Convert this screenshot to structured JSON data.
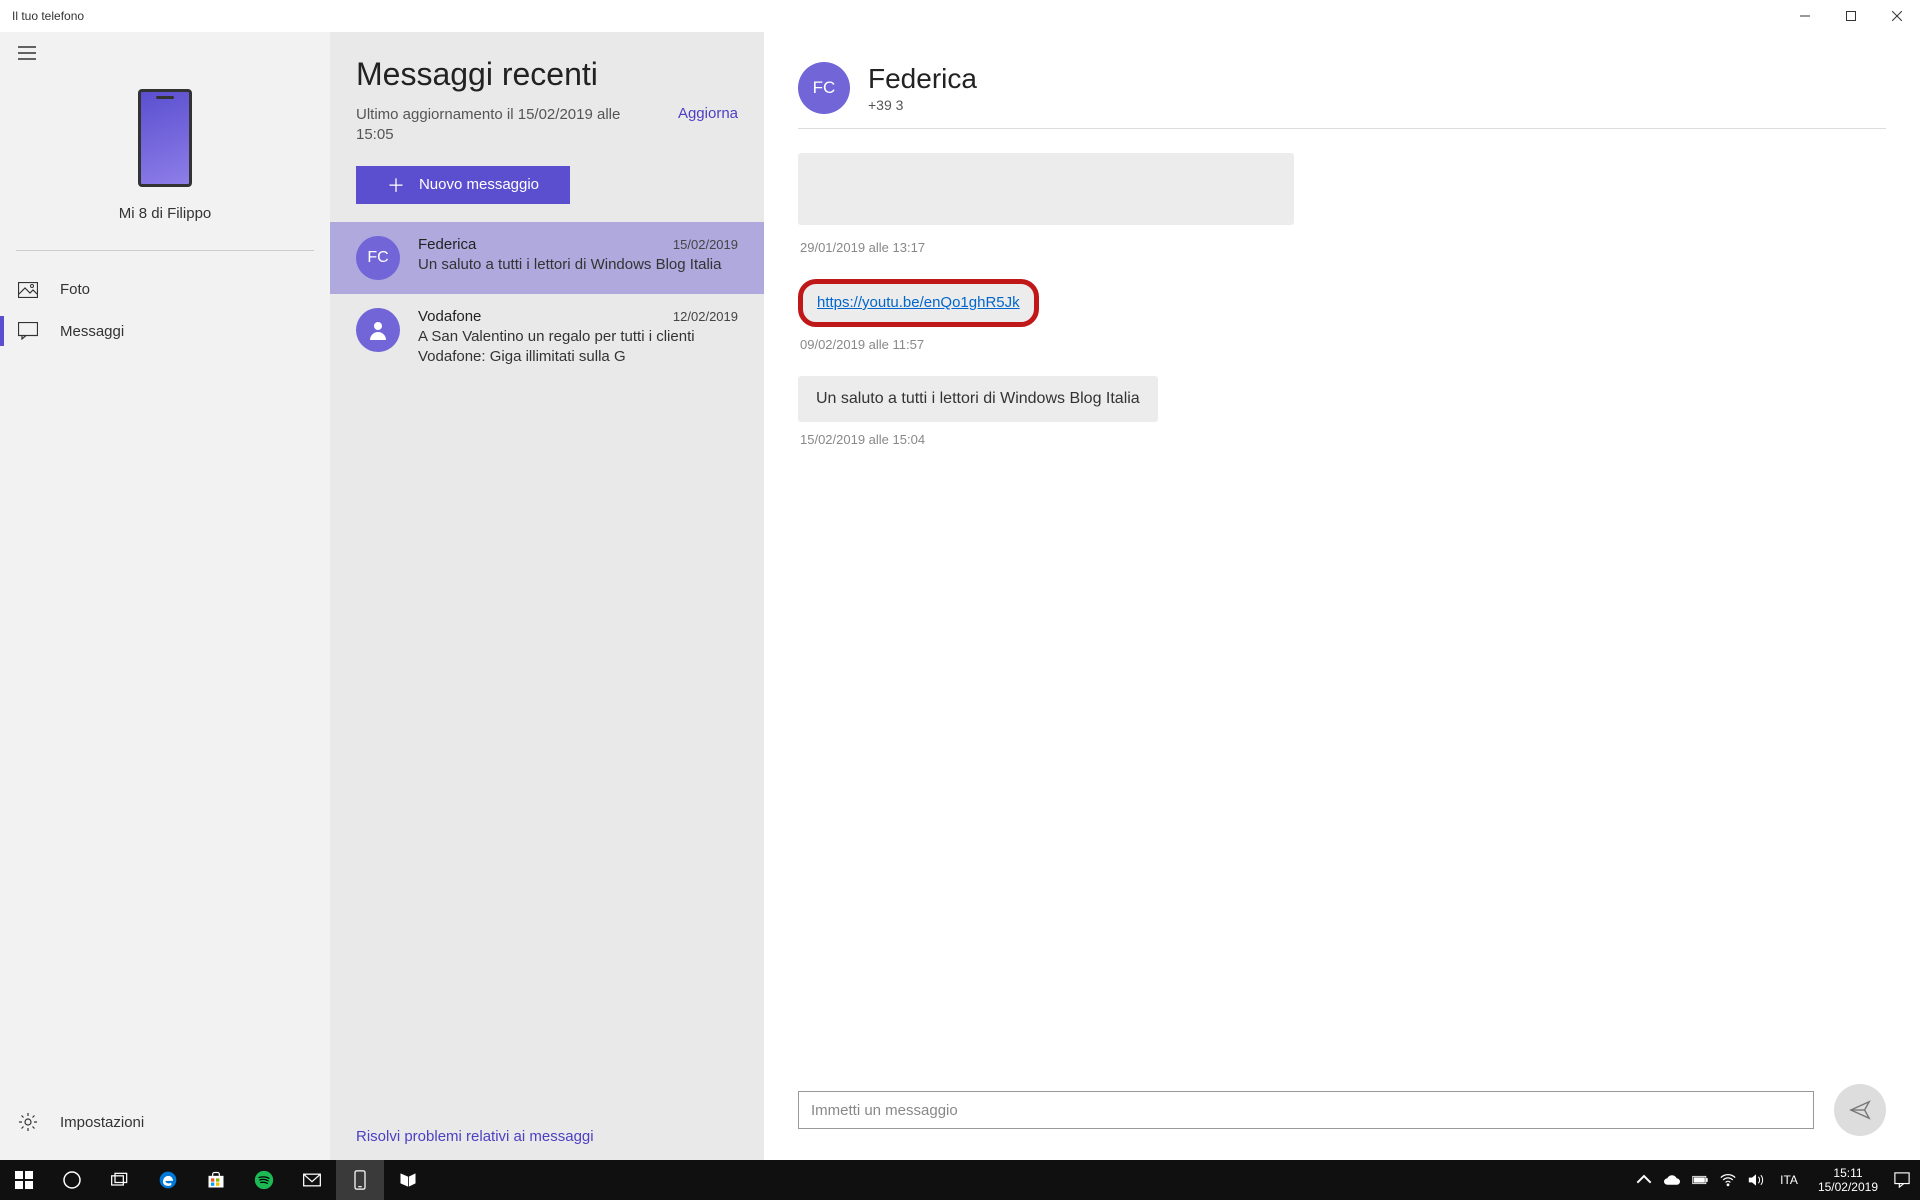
{
  "window": {
    "title": "Il tuo telefono"
  },
  "sidebar": {
    "phone_label": "Mi 8 di Filippo",
    "nav": [
      {
        "label": "Foto"
      },
      {
        "label": "Messaggi"
      }
    ],
    "settings_label": "Impostazioni"
  },
  "messages_panel": {
    "title": "Messaggi recenti",
    "last_update": "Ultimo aggiornamento il 15/02/2019 alle 15:05",
    "refresh": "Aggiorna",
    "new_message": "Nuovo messaggio",
    "conversations": [
      {
        "initials": "FC",
        "name": "Federica",
        "date": "15/02/2019",
        "preview": "Un saluto a tutti i lettori di Windows Blog Italia"
      },
      {
        "initials": "",
        "name": "Vodafone",
        "date": "12/02/2019",
        "preview": "A San Valentino un regalo per tutti i clienti Vodafone: Giga illimitati sulla G"
      }
    ],
    "footer_link": "Risolvi problemi relativi ai messaggi"
  },
  "chat": {
    "initials": "FC",
    "name": "Federica",
    "phone": "+39 3",
    "messages": [
      {
        "text": "",
        "time": "29/01/2019 alle 13:17"
      },
      {
        "link": "https://youtu.be/enQo1ghR5Jk",
        "time": "09/02/2019 alle 11:57"
      },
      {
        "text": "Un saluto a tutti i lettori di Windows Blog Italia",
        "time": "15/02/2019 alle 15:04"
      }
    ],
    "input_placeholder": "Immetti un messaggio"
  },
  "taskbar": {
    "lang": "ITA",
    "time": "15:11",
    "date": "15/02/2019"
  }
}
